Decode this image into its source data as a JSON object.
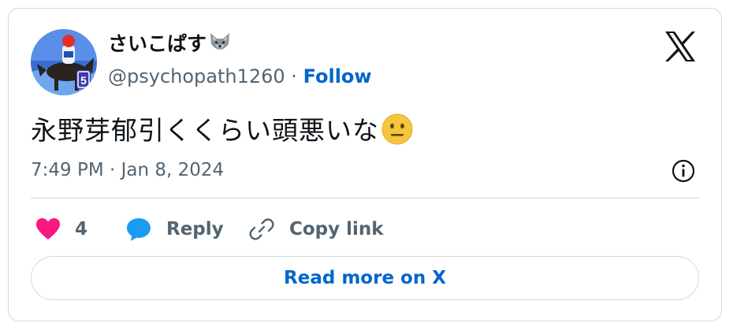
{
  "author": {
    "display_name": "さいこぱす",
    "name_emoji_icon": "wolf-face-icon",
    "handle": "@psychopath1260",
    "separator": " · ",
    "follow_label": "Follow"
  },
  "tweet": {
    "text": "永野芽郁引くくらい頭悪いな",
    "text_emoji_icon": "neutral-face-icon",
    "timestamp": "7:49 PM · Jan 8, 2024"
  },
  "actions": {
    "like_count": "4",
    "reply_label": "Reply",
    "copy_link_label": "Copy link"
  },
  "read_more_label": "Read more on X",
  "colors": {
    "accent": "#0066cc",
    "like": "#f91880",
    "reply": "#1d9bf0",
    "muted": "#536471",
    "border": "#cfd9de"
  }
}
